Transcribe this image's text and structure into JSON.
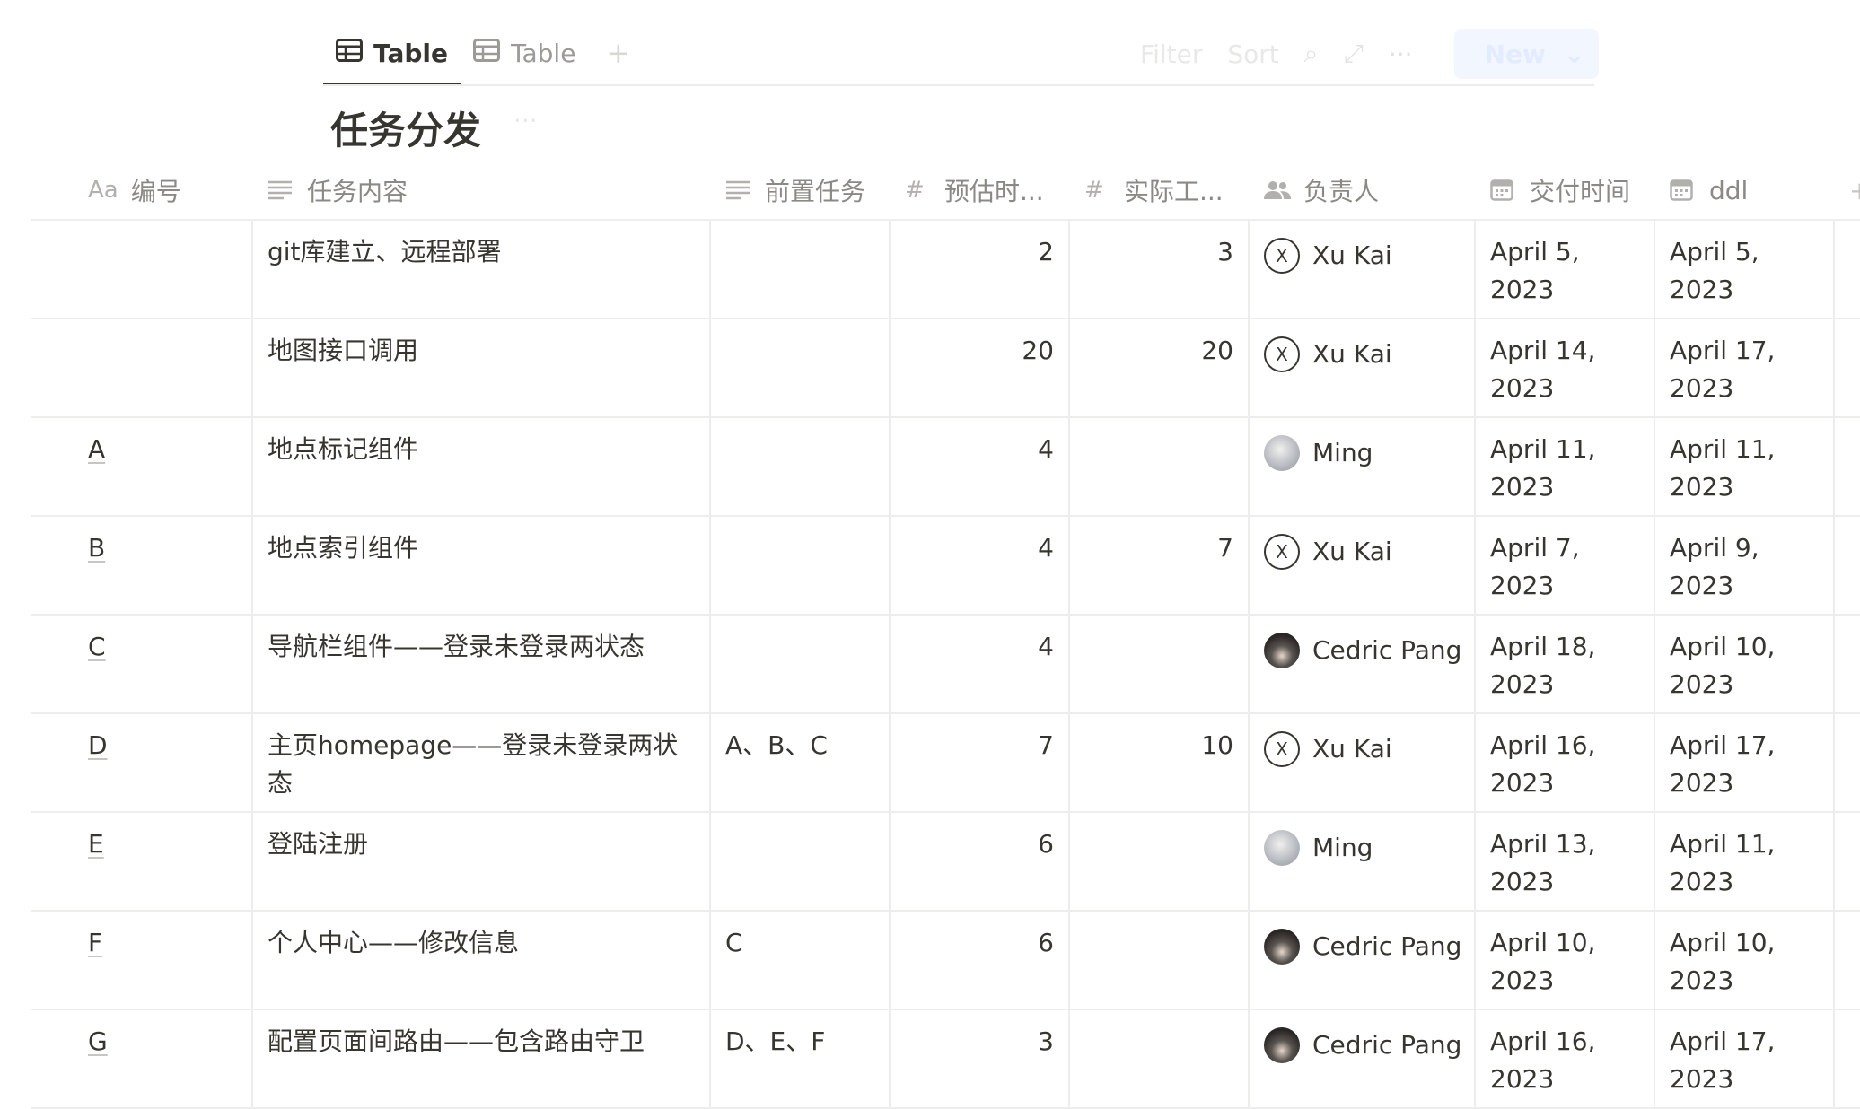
{
  "tabs": [
    {
      "label": "Table",
      "active": true
    },
    {
      "label": "Table",
      "active": false
    }
  ],
  "toolbar": {
    "filter": "Filter",
    "sort": "Sort",
    "new_label": "New"
  },
  "page_title": "任务分发",
  "columns": [
    {
      "icon": "text-type-icon",
      "icon_text": "Aa",
      "label": "编号"
    },
    {
      "icon": "text-lines-icon",
      "label": "任务内容"
    },
    {
      "icon": "text-lines-icon",
      "label": "前置任务"
    },
    {
      "icon": "number-icon",
      "label": "预估时..."
    },
    {
      "icon": "number-icon",
      "label": "实际工..."
    },
    {
      "icon": "people-icon",
      "label": "负责人"
    },
    {
      "icon": "calendar-icon",
      "label": "交付时间"
    },
    {
      "icon": "calendar-icon",
      "label": "ddl"
    }
  ],
  "rows": [
    {
      "code": "",
      "task": "git库建立、远程部署",
      "prereq": "",
      "est": "2",
      "actual": "3",
      "owner": "Xu Kai",
      "owner_avatar": "x-avatar",
      "deliver": "April 5, 2023",
      "ddl": "April 5, 2023"
    },
    {
      "code": "",
      "task": "地图接口调用",
      "prereq": "",
      "est": "20",
      "actual": "20",
      "owner": "Xu Kai",
      "owner_avatar": "x-avatar",
      "deliver": "April 14, 2023",
      "ddl": "April 17, 2023"
    },
    {
      "code": "A",
      "task": "地点标记组件",
      "prereq": "",
      "est": "4",
      "actual": "",
      "owner": "Ming",
      "owner_avatar": "ming-avatar",
      "deliver": "April 11, 2023",
      "ddl": "April 11, 2023"
    },
    {
      "code": "B",
      "task": "地点索引组件",
      "prereq": "",
      "est": "4",
      "actual": "7",
      "owner": "Xu Kai",
      "owner_avatar": "x-avatar",
      "deliver": "April 7, 2023",
      "ddl": "April 9, 2023"
    },
    {
      "code": "C",
      "task": "导航栏组件——登录未登录两状态",
      "prereq": "",
      "est": "4",
      "actual": "",
      "owner": "Cedric Pang",
      "owner_avatar": "cedric-avatar",
      "deliver": "April 18, 2023",
      "ddl": "April 10, 2023"
    },
    {
      "code": "D",
      "task": "主页homepage——登录未登录两状态",
      "prereq": "A、B、C",
      "est": "7",
      "actual": "10",
      "owner": "Xu Kai",
      "owner_avatar": "x-avatar",
      "deliver": "April 16, 2023",
      "ddl": "April 17, 2023"
    },
    {
      "code": "E",
      "task": "登陆注册",
      "prereq": "",
      "est": "6",
      "actual": "",
      "owner": "Ming",
      "owner_avatar": "ming-avatar",
      "deliver": "April 13, 2023",
      "ddl": "April 11, 2023"
    },
    {
      "code": "F",
      "task": "个人中心——修改信息",
      "prereq": "C",
      "est": "6",
      "actual": "",
      "owner": "Cedric Pang",
      "owner_avatar": "cedric-avatar",
      "deliver": "April 10, 2023",
      "ddl": "April 10, 2023"
    },
    {
      "code": "G",
      "task": "配置页面间路由——包含路由守卫",
      "prereq": "D、E、F",
      "est": "3",
      "actual": "",
      "owner": "Cedric Pang",
      "owner_avatar": "cedric-avatar",
      "deliver": "April 16, 2023",
      "ddl": "April 17, 2023"
    }
  ]
}
